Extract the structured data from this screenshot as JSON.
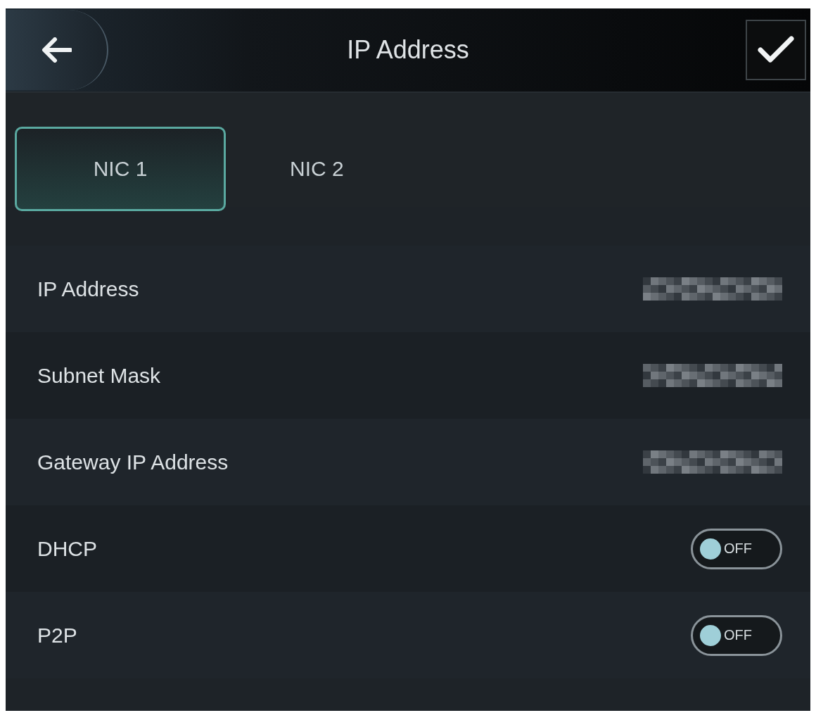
{
  "header": {
    "title": "IP Address"
  },
  "tabs": [
    {
      "label": "NIC 1",
      "selected": true
    },
    {
      "label": "NIC 2",
      "selected": false
    }
  ],
  "rows": [
    {
      "kind": "value",
      "label": "IP Address"
    },
    {
      "kind": "value",
      "label": "Subnet Mask"
    },
    {
      "kind": "value",
      "label": "Gateway IP Address"
    },
    {
      "kind": "toggle",
      "label": "DHCP",
      "on": false,
      "state_label": "OFF"
    },
    {
      "kind": "toggle",
      "label": "P2P",
      "on": false,
      "state_label": "OFF"
    }
  ]
}
